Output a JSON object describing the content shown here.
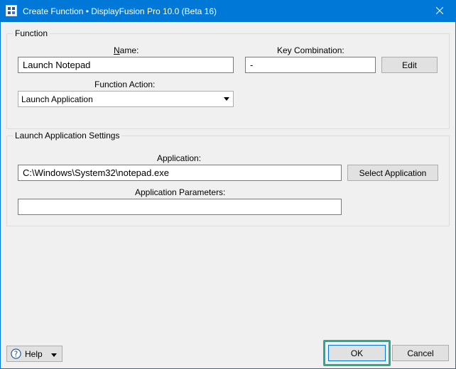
{
  "window": {
    "title": "Create Function • DisplayFusion Pro 10.0 (Beta 16)",
    "close_icon": "close-icon",
    "accent_color": "#0078d7"
  },
  "function_group": {
    "legend": "Function",
    "name_label_underlined": "N",
    "name_label_rest": "ame:",
    "name_value": "Launch Notepad",
    "key_combination_label": "Key Combination:",
    "key_combination_value": "-",
    "edit_label": "Edit",
    "function_action_label": "Function Action:",
    "function_action_value": "Launch Application"
  },
  "launch_settings_group": {
    "legend": "Launch Application Settings",
    "application_label": "Application:",
    "application_value": "C:\\Windows\\System32\\notepad.exe",
    "select_application_label": "Select Application",
    "parameters_label": "Application Parameters:",
    "parameters_value": ""
  },
  "footer": {
    "help_label": "Help",
    "ok_label": "OK",
    "cancel_label": "Cancel",
    "highlight_color": "#2aa98b"
  }
}
